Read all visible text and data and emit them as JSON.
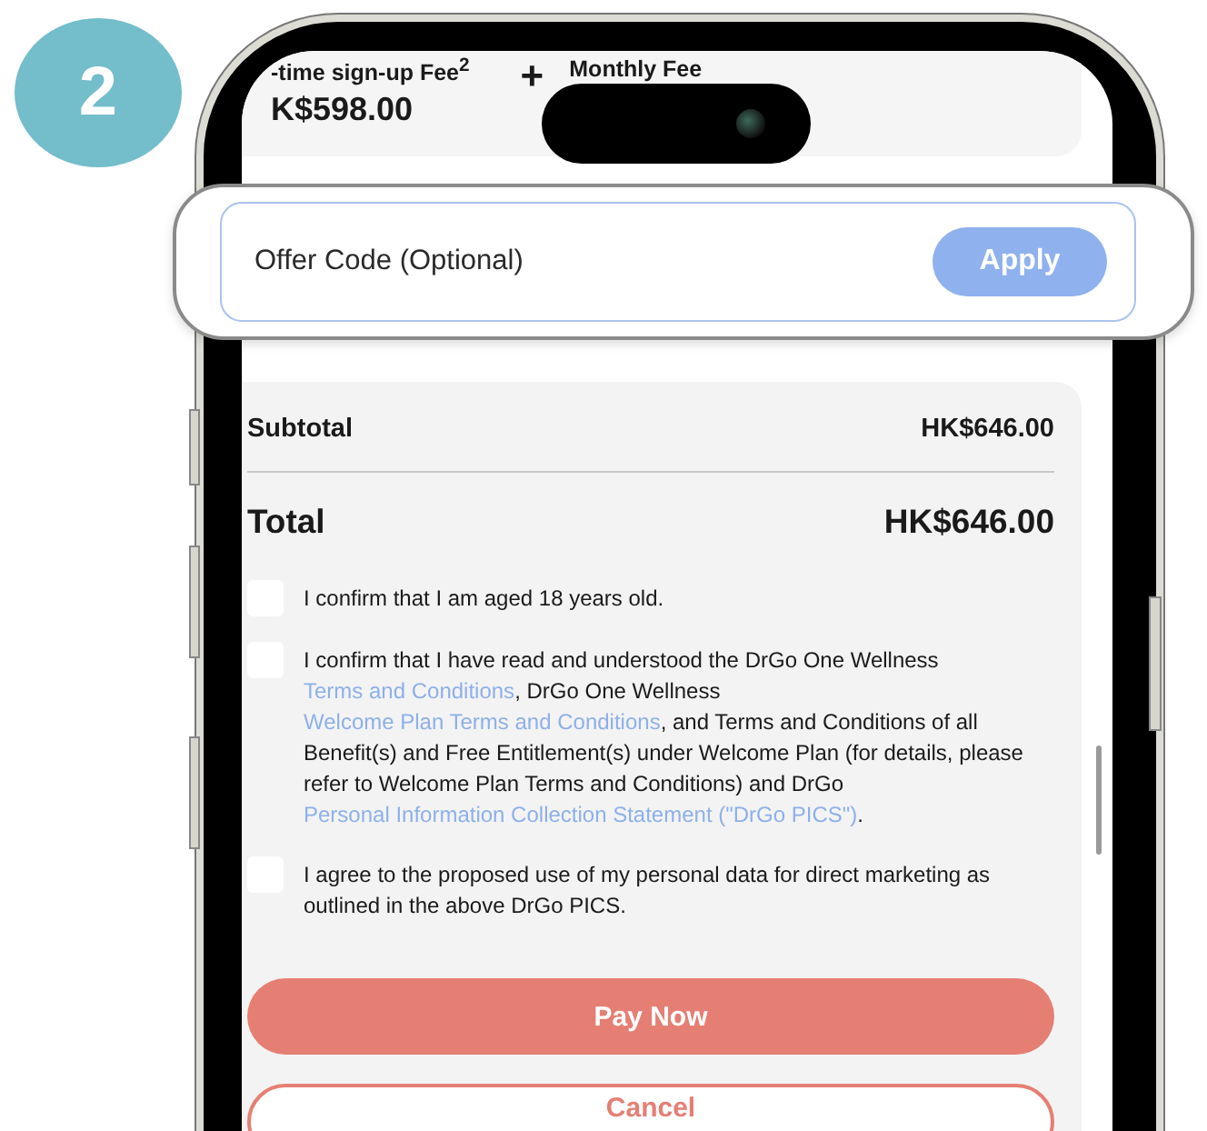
{
  "step_badge": "2",
  "fees": {
    "signup_label": "-time sign-up Fee$^{2}$",
    "signup_amount": "K$598.00",
    "operator": "+",
    "monthly_label": "Monthly Fee"
  },
  "offer_code": {
    "placeholder": "Offer Code (Optional)",
    "apply_button": "Apply"
  },
  "summary": {
    "subtotal_label": "Subtotal",
    "subtotal": "HK$646.00",
    "total_label": "Total",
    "total": "HK$646.00"
  },
  "consents": [
    {
      "checked": false,
      "parts": [
        {
          "kind": "text",
          "text": "I confirm that I am aged 18 years old."
        }
      ]
    },
    {
      "checked": false,
      "parts": [
        {
          "kind": "text",
          "text": "I confirm that I have read and understood the DrGo One Wellness "
        },
        {
          "kind": "link",
          "text": "Terms and Conditions"
        },
        {
          "kind": "text",
          "text": ", DrGo One Wellness "
        },
        {
          "kind": "link",
          "text": "Welcome Plan Terms and Conditions"
        },
        {
          "kind": "text",
          "text": ", and Terms and Conditions of all Benefit(s) and Free Entitlement(s) under Welcome Plan (for details, please refer to Welcome Plan Terms and Conditions) and DrGo "
        },
        {
          "kind": "link",
          "text": "Personal Information Collection Statement (\"DrGo PICS\")"
        },
        {
          "kind": "text",
          "text": "."
        }
      ]
    },
    {
      "checked": false,
      "parts": [
        {
          "kind": "text",
          "text": "I agree to the proposed use of my personal data for direct marketing as outlined in the above DrGo PICS."
        }
      ]
    }
  ],
  "buttons": {
    "pay": "Pay Now",
    "cancel": "Cancel"
  }
}
